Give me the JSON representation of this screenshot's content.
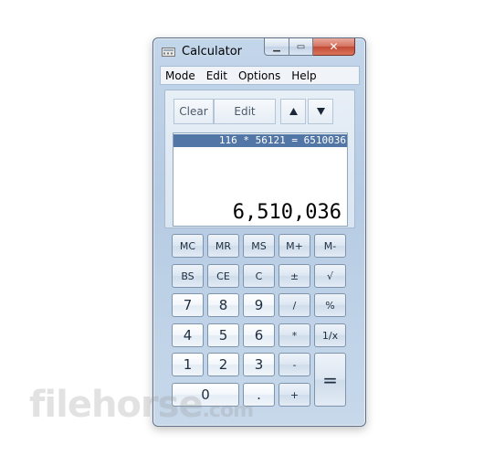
{
  "window": {
    "title": "Calculator",
    "icon": "calculator-icon"
  },
  "menu": [
    "Mode",
    "Edit",
    "Options",
    "Help"
  ],
  "history_controls": {
    "clear": "Clear",
    "edit": "Edit",
    "up_icon": "arrow-up-icon",
    "down_icon": "arrow-down-icon"
  },
  "display": {
    "history_entry": "116 * 56121 = 6510036",
    "value": "6,510,036"
  },
  "keys": {
    "mc": "MC",
    "mr": "MR",
    "ms": "MS",
    "mplus": "M+",
    "mminus": "M-",
    "bs": "BS",
    "ce": "CE",
    "c": "C",
    "plusminus": "±",
    "sqrt": "√",
    "d7": "7",
    "d8": "8",
    "d9": "9",
    "div": "/",
    "pct": "%",
    "d4": "4",
    "d5": "5",
    "d6": "6",
    "mul": "*",
    "recip": "1/x",
    "d1": "1",
    "d2": "2",
    "d3": "3",
    "sub": "-",
    "eq": "=",
    "d0": "0",
    "dot": ".",
    "add": "+"
  },
  "watermark": {
    "main": "filehorse",
    "suffix": ".com"
  }
}
